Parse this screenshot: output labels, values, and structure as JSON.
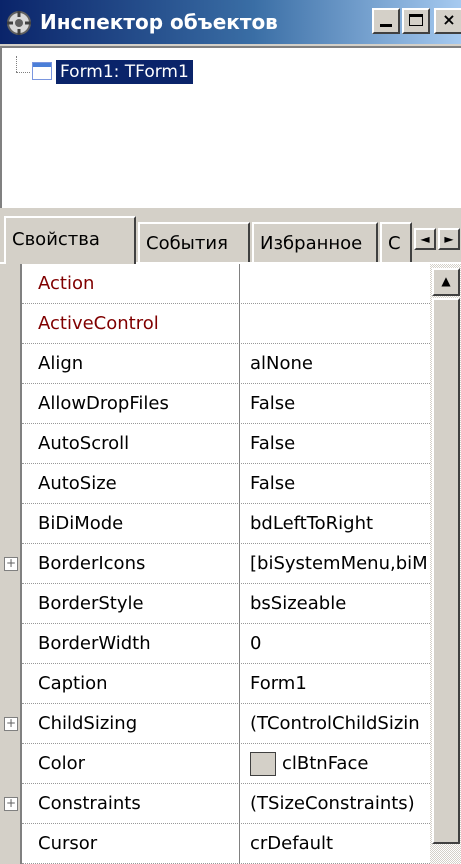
{
  "window": {
    "title": "Инспектор объектов",
    "icon": "object-inspector-icon",
    "controls": {
      "minimize": "_",
      "maximize": "□",
      "close": "×"
    }
  },
  "tree": {
    "items": [
      {
        "label": "Form1: TForm1",
        "icon": "form-icon",
        "selected": true
      }
    ]
  },
  "tabs": [
    {
      "label": "Свойства",
      "active": true
    },
    {
      "label": "События",
      "active": false
    },
    {
      "label": "Избранное",
      "active": false
    },
    {
      "label": "С",
      "active": false
    }
  ],
  "tab_scroll": {
    "left": "◄",
    "right": "►"
  },
  "scrollbar": {
    "up": "▲"
  },
  "properties": [
    {
      "name": "Action",
      "value": "",
      "highlight": true
    },
    {
      "name": "ActiveControl",
      "value": "",
      "highlight": true
    },
    {
      "name": "Align",
      "value": "alNone"
    },
    {
      "name": "AllowDropFiles",
      "value": "False"
    },
    {
      "name": "AutoScroll",
      "value": "False"
    },
    {
      "name": "AutoSize",
      "value": "False"
    },
    {
      "name": "BiDiMode",
      "value": "bdLeftToRight"
    },
    {
      "name": "BorderIcons",
      "value": "[biSystemMenu,biM",
      "expandable": true
    },
    {
      "name": "BorderStyle",
      "value": "bsSizeable"
    },
    {
      "name": "BorderWidth",
      "value": "0"
    },
    {
      "name": "Caption",
      "value": "Form1"
    },
    {
      "name": "ChildSizing",
      "value": "(TControlChildSizin",
      "expandable": true
    },
    {
      "name": "Color",
      "value": "clBtnFace",
      "swatch": "#d4d0c8"
    },
    {
      "name": "Constraints",
      "value": "(TSizeConstraints)",
      "expandable": true
    },
    {
      "name": "Cursor",
      "value": "crDefault"
    }
  ],
  "colors": {
    "title_start": "#0a246a",
    "highlight_name": "#800000",
    "selection": "#0a246a"
  }
}
